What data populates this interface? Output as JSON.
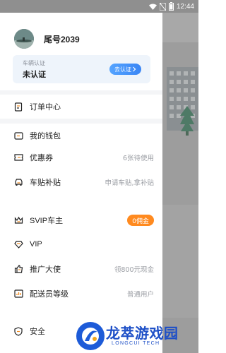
{
  "status_bar": {
    "time": "12:44"
  },
  "profile": {
    "username": "尾号2039",
    "certification": {
      "label": "车辆认证",
      "status": "未认证",
      "button": "去认证"
    }
  },
  "menu": {
    "orders": {
      "label": "订单中心"
    },
    "wallet": {
      "label": "我的钱包"
    },
    "coupons": {
      "label": "优惠券",
      "meta": "6张待使用"
    },
    "sticker": {
      "label": "车贴补贴",
      "meta": "申请车贴,拿补贴"
    },
    "svip": {
      "label": "SVIP车主",
      "badge": "0佣金"
    },
    "vip": {
      "label": "VIP"
    },
    "promoter": {
      "label": "推广大使",
      "meta": "领800元现金"
    },
    "courier_level": {
      "label": "配送员等级",
      "meta": "普通用户"
    },
    "safety": {
      "label": "安全"
    }
  },
  "watermark": {
    "title": "龙萃游戏园",
    "subtitle": "LONGCUI TECH"
  },
  "colors": {
    "accent": "#3a86f5",
    "badge": "#ff8a1f",
    "drawer_bg": "#f4f5f7"
  }
}
